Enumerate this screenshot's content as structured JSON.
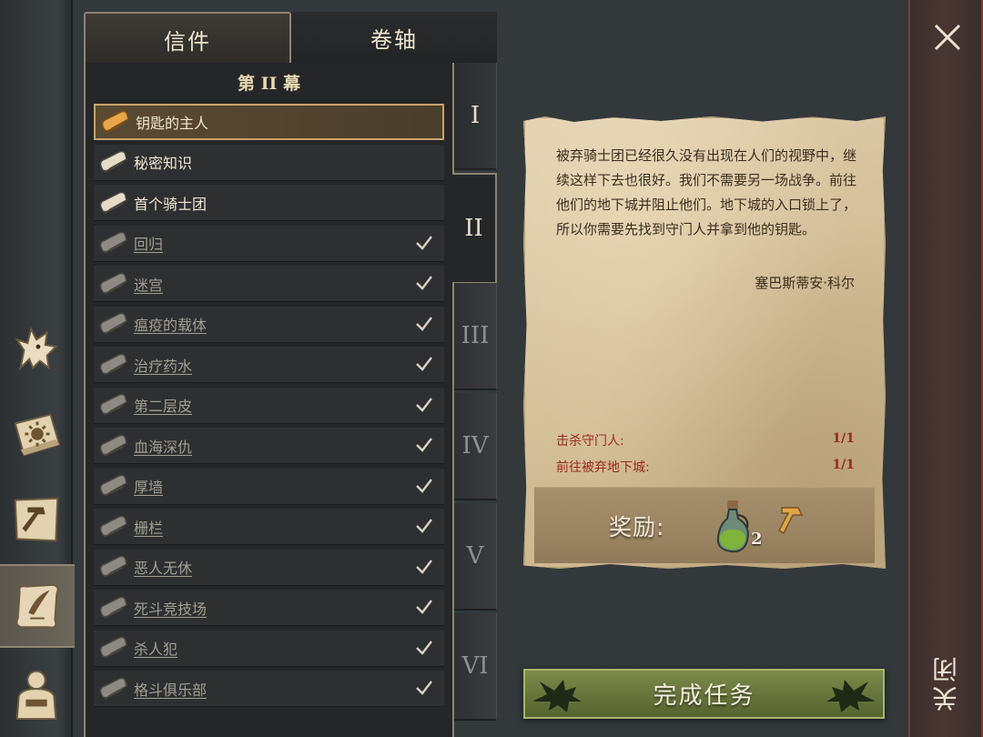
{
  "tabs": {
    "letters": "信件",
    "scrolls": "卷轴"
  },
  "act_title": "第 II 幕",
  "quests": [
    {
      "label": "钥匙的主人",
      "done": false,
      "selected": true
    },
    {
      "label": "秘密知识",
      "done": false,
      "selected": false
    },
    {
      "label": "首个骑士团",
      "done": false,
      "selected": false
    },
    {
      "label": "回归",
      "done": true,
      "selected": false
    },
    {
      "label": "迷宫",
      "done": true,
      "selected": false
    },
    {
      "label": "瘟疫的载体",
      "done": true,
      "selected": false
    },
    {
      "label": "治疗药水",
      "done": true,
      "selected": false
    },
    {
      "label": "第二层皮",
      "done": true,
      "selected": false
    },
    {
      "label": "血海深仇",
      "done": true,
      "selected": false
    },
    {
      "label": "厚墙",
      "done": true,
      "selected": false
    },
    {
      "label": "栅栏",
      "done": true,
      "selected": false
    },
    {
      "label": "恶人无休",
      "done": true,
      "selected": false
    },
    {
      "label": "死斗竞技场",
      "done": true,
      "selected": false
    },
    {
      "label": "杀人犯",
      "done": true,
      "selected": false
    },
    {
      "label": "格斗俱乐部",
      "done": true,
      "selected": false
    }
  ],
  "acts": [
    "I",
    "II",
    "III",
    "IV",
    "V",
    "VI"
  ],
  "current_act": "II",
  "letter": {
    "body": "被弃骑士团已经很久没有出现在人们的视野中，继续这样下去也很好。我们不需要另一场战争。前往他们的地下城并阻止他们。地下城的入口锁上了，所以你需要先找到守门人并拿到他的钥匙。",
    "signature": "塞巴斯蒂安·科尔",
    "objectives": [
      {
        "label": "击杀守门人:",
        "count": "1/1"
      },
      {
        "label": "前往被弃地下城:",
        "count": "1/1"
      }
    ],
    "reward_label": "奖励:",
    "reward_potion_count": "2",
    "reward_icons": [
      "potion-icon",
      "hammer-icon"
    ]
  },
  "complete_button": "完成任务",
  "close": {
    "label": "关闭",
    "icon": "close-icon"
  },
  "sidebar_icons": [
    "wolf-icon",
    "sun-book-icon",
    "hammer-map-icon",
    "quest-scroll-icon",
    "character-icon"
  ],
  "colors": {
    "background": "#33383b",
    "parchment": "#d3bf98",
    "objective_red": "#9a2a1e",
    "complete_green": "#66743a",
    "selected_border": "#c8a36c",
    "close_strip_border": "#7a3d34"
  }
}
